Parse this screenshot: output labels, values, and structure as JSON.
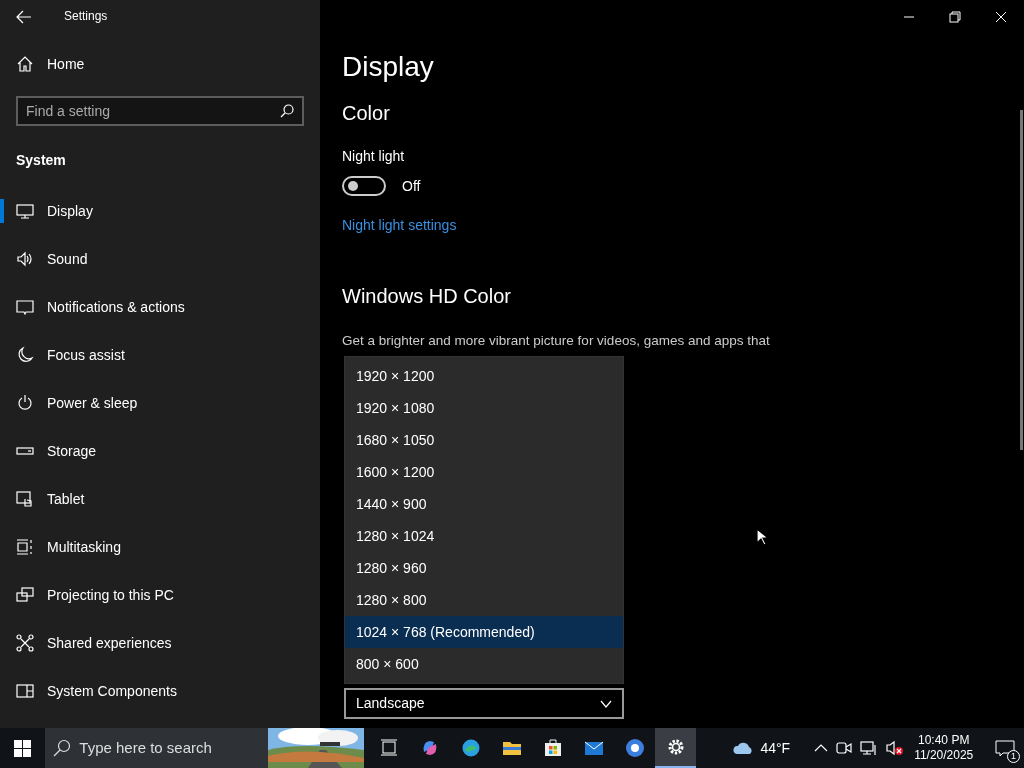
{
  "window": {
    "title": "Settings"
  },
  "sidebar": {
    "home": "Home",
    "search": {
      "placeholder": "Find a setting"
    },
    "section": "System",
    "items": [
      {
        "label": "Display",
        "selected": true
      },
      {
        "label": "Sound",
        "selected": false
      },
      {
        "label": "Notifications & actions",
        "selected": false
      },
      {
        "label": "Focus assist",
        "selected": false
      },
      {
        "label": "Power & sleep",
        "selected": false
      },
      {
        "label": "Storage",
        "selected": false
      },
      {
        "label": "Tablet",
        "selected": false
      },
      {
        "label": "Multitasking",
        "selected": false
      },
      {
        "label": "Projecting to this PC",
        "selected": false
      },
      {
        "label": "Shared experiences",
        "selected": false
      },
      {
        "label": "System Components",
        "selected": false
      }
    ]
  },
  "main": {
    "title": "Display",
    "color_section": "Color",
    "night_light": {
      "label": "Night light",
      "on": false,
      "state_text": "Off",
      "link": "Night light settings"
    },
    "hd_color": {
      "heading": "Windows HD Color",
      "description": "Get a brighter and more vibrant picture for videos, games and apps that"
    },
    "resolution_options": [
      {
        "label": "1920 × 1200",
        "selected": false
      },
      {
        "label": "1920 × 1080",
        "selected": false
      },
      {
        "label": "1680 × 1050",
        "selected": false
      },
      {
        "label": "1600 × 1200",
        "selected": false
      },
      {
        "label": "1440 × 900",
        "selected": false
      },
      {
        "label": "1280 × 1024",
        "selected": false
      },
      {
        "label": "1280 × 960",
        "selected": false
      },
      {
        "label": "1280 × 800",
        "selected": false
      },
      {
        "label": "1024 × 768 (Recommended)",
        "selected": true
      },
      {
        "label": "800 × 600",
        "selected": false
      }
    ],
    "orientation": {
      "value": "Landscape"
    }
  },
  "taskbar": {
    "search": {
      "placeholder": "Type here to search"
    },
    "apps": [
      {
        "kind": "taskview",
        "active": false
      },
      {
        "kind": "copilot",
        "active": false
      },
      {
        "kind": "edge",
        "active": false
      },
      {
        "kind": "explorer",
        "active": false
      },
      {
        "kind": "store",
        "active": false
      },
      {
        "kind": "mail",
        "active": false
      },
      {
        "kind": "chrome",
        "active": false
      },
      {
        "kind": "settings",
        "active": true
      }
    ],
    "weather": {
      "temperature": "44°F"
    },
    "time": "10:40 PM",
    "date": "11/20/2025",
    "notifications": "1"
  }
}
